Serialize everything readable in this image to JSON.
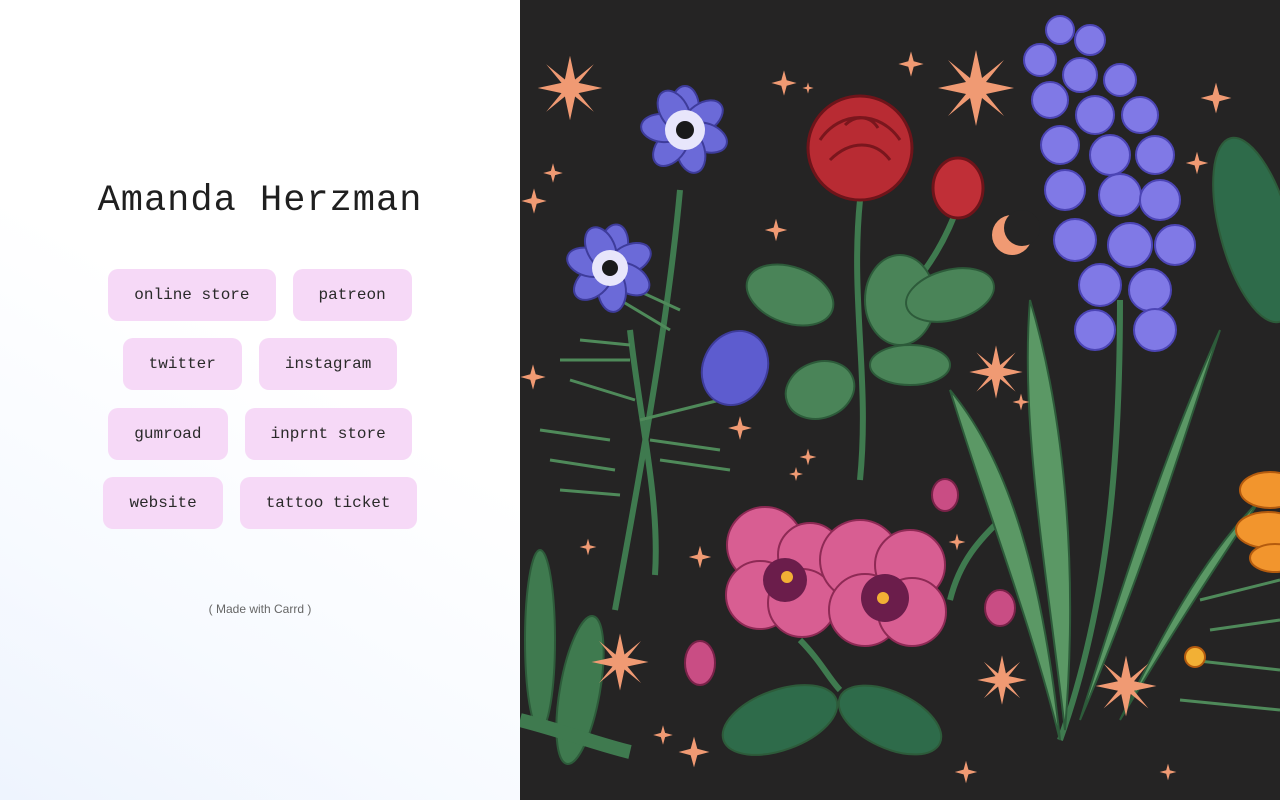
{
  "profile": {
    "name": "Amanda Herzman"
  },
  "links": [
    {
      "label": "online store"
    },
    {
      "label": "patreon"
    },
    {
      "label": "twitter"
    },
    {
      "label": "instagram"
    },
    {
      "label": "gumroad"
    },
    {
      "label": "inprnt store"
    },
    {
      "label": "website"
    },
    {
      "label": "tattoo ticket"
    }
  ],
  "footer": {
    "credit": "( Made with Carrd )"
  },
  "colors": {
    "button_bg": "#f6d9f7",
    "art_bg": "#252424",
    "star": "#f09a73"
  }
}
